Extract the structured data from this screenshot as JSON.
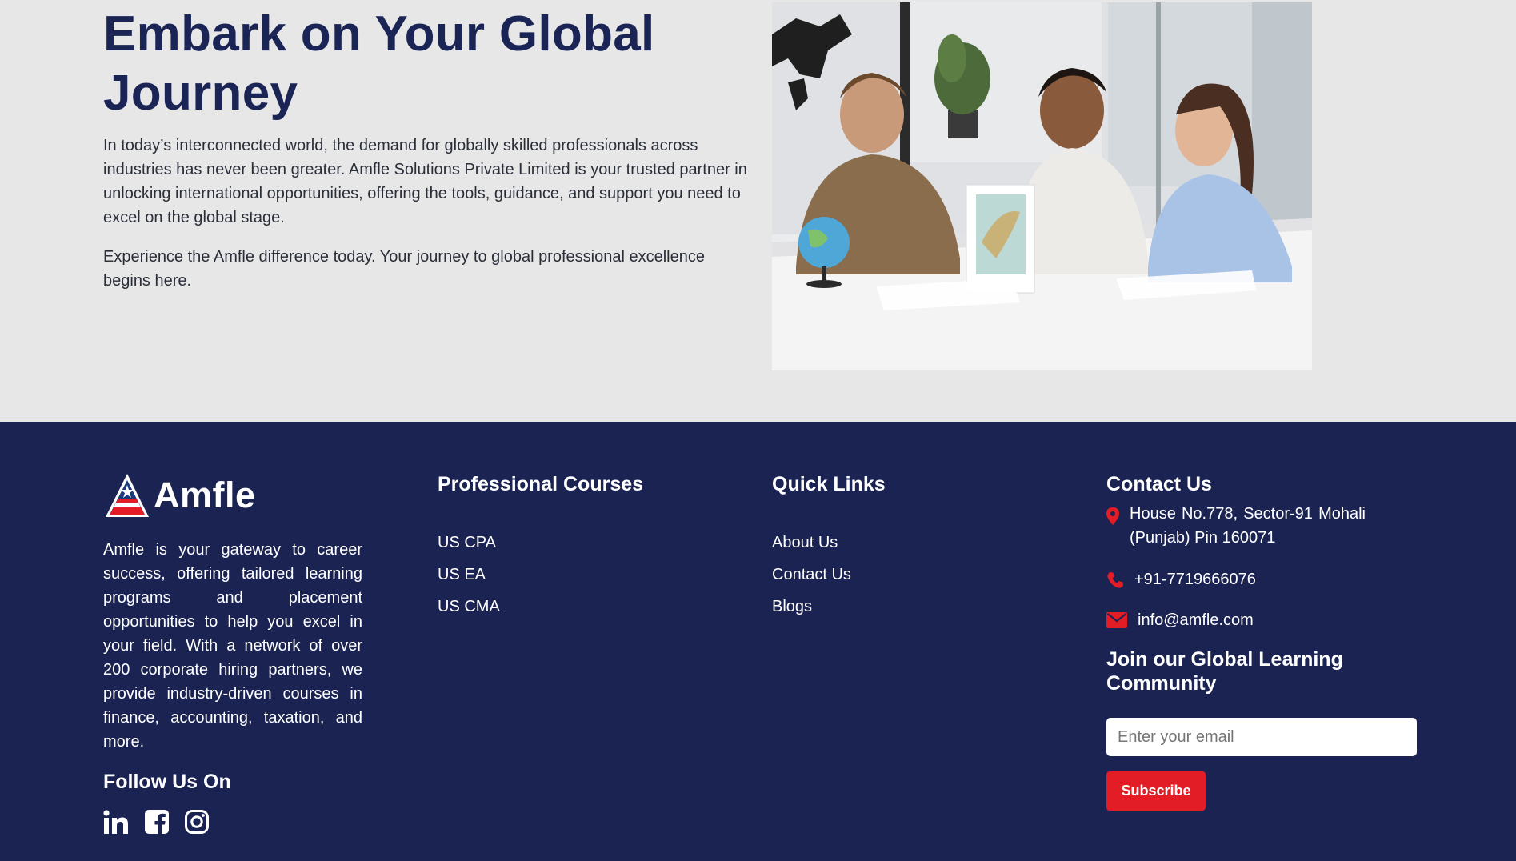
{
  "hero": {
    "title": "Embark on Your Global Journey",
    "paragraph1": "In today’s interconnected world, the demand for globally skilled professionals across industries has never been greater. Amfle Solutions Private Limited is your trusted partner in unlocking international opportunities, offering the tools, guidance, and support you need to excel on the global stage.",
    "paragraph2": "Experience the Amfle difference today. Your journey to global professional excellence begins here."
  },
  "footer": {
    "brand": {
      "name": "Amfle",
      "description": "Amfle is your gateway to career success, offering tailored learning programs and placement opportunities to help you excel in your field. With a network of over 200 corporate hiring partners, we provide industry-driven courses in finance, accounting, taxation, and more."
    },
    "follow": {
      "title": "Follow Us On",
      "icons": [
        "linkedin-icon",
        "facebook-icon",
        "instagram-icon"
      ]
    },
    "courses": {
      "title": "Professional Courses",
      "items": [
        "US CPA",
        "US EA",
        "US CMA"
      ]
    },
    "quick_links": {
      "title": "Quick Links",
      "items": [
        "About Us",
        "Contact Us",
        "Blogs"
      ]
    },
    "contact": {
      "title": "Contact Us",
      "address": "House No.778, Sector-91 Mohali (Punjab) Pin 160071",
      "phone": "+91-7719666076",
      "email": "info@amfle.com"
    },
    "newsletter": {
      "title": "Join our Global Learning Community",
      "placeholder": "Enter your email",
      "button_label": "Subscribe"
    }
  },
  "colors": {
    "navy": "#1b2352",
    "accent_red": "#e31d25",
    "hero_background": "#e7e7e8"
  }
}
